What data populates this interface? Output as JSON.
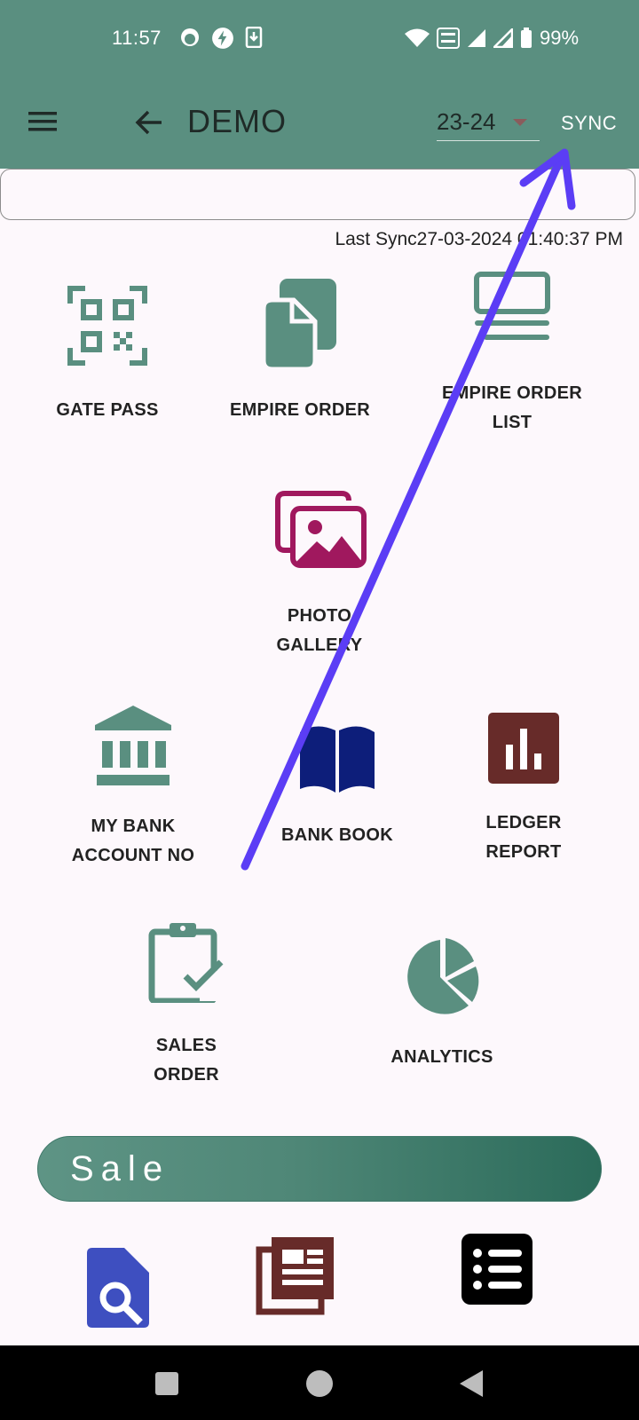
{
  "status_bar": {
    "time": "11:57",
    "battery": "99%"
  },
  "app_bar": {
    "title": "DEMO",
    "year_value": "23-24",
    "sync_label": "SYNC"
  },
  "search": {
    "placeholder": ""
  },
  "last_sync": "Last Sync27-03-2024 01:40:37 PM",
  "tiles": [
    {
      "label": "GATE PASS",
      "icon": "qr-code-icon"
    },
    {
      "label": "EMPIRE ORDER",
      "icon": "document-phone-icon"
    },
    {
      "label_line1": "EMPIRE ORDER",
      "label_line2": "LIST",
      "icon": "monitor-list-icon"
    },
    {
      "label_line1": "PHOTO",
      "label_line2": "GALLERY",
      "icon": "gallery-icon"
    },
    {
      "label_line1": "MY BANK",
      "label_line2": "ACCOUNT NO",
      "icon": "bank-icon"
    },
    {
      "label": "BANK BOOK",
      "icon": "book-icon"
    },
    {
      "label_line1": "LEDGER",
      "label_line2": "REPORT",
      "icon": "bar-chart-icon"
    },
    {
      "label_line1": "SALES",
      "label_line2": "ORDER",
      "icon": "clipboard-check-icon"
    },
    {
      "label": "ANALYTICS",
      "icon": "pie-chart-icon"
    }
  ],
  "sale_section": {
    "label": "Sale"
  },
  "colors": {
    "primary": "#5a8f80",
    "gallery": "#a0185e",
    "book": "#0d1e7a",
    "ledger": "#672b29",
    "search_doc": "#3e4fc0",
    "annotation": "#5b3df5"
  }
}
